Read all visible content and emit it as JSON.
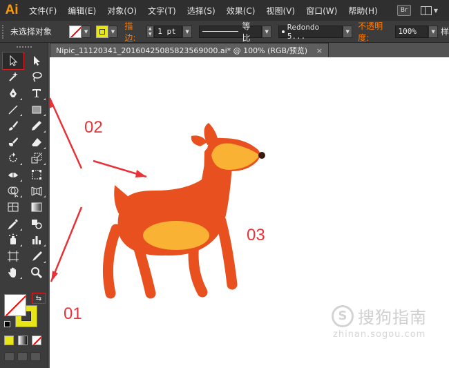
{
  "app": {
    "logo": "Ai",
    "bridge_label": "Br",
    "menus": [
      "文件(F)",
      "编辑(E)",
      "对象(O)",
      "文字(T)",
      "选择(S)",
      "效果(C)",
      "视图(V)",
      "窗口(W)",
      "帮助(H)"
    ]
  },
  "control": {
    "selection_status": "未选择对象",
    "stroke_label": "描边:",
    "stroke_weight": "1 pt",
    "stroke_profile": "等比",
    "brush": "Redondo 5...",
    "opacity_label": "不透明度:",
    "opacity_value": "100%",
    "trailing": "样"
  },
  "document": {
    "tab_title": "Nipic_11120341_20160425085823569000.ai* @ 100% (RGB/预览)",
    "close_symbol": "×"
  },
  "tools": [
    {
      "name": "selection-tool",
      "icon": "arrow-icon",
      "selected": true
    },
    {
      "name": "direct-selection-tool",
      "icon": "white-arrow-icon"
    },
    {
      "name": "magic-wand-tool",
      "icon": "magic-wand-icon"
    },
    {
      "name": "lasso-tool",
      "icon": "lasso-icon"
    },
    {
      "name": "pen-tool",
      "icon": "pen-icon"
    },
    {
      "name": "type-tool",
      "icon": "type-icon"
    },
    {
      "name": "line-tool",
      "icon": "line-icon"
    },
    {
      "name": "rectangle-tool",
      "icon": "rectangle-icon"
    },
    {
      "name": "paintbrush-tool",
      "icon": "brush-icon"
    },
    {
      "name": "pencil-tool",
      "icon": "pencil-icon"
    },
    {
      "name": "blob-brush-tool",
      "icon": "blob-brush-icon"
    },
    {
      "name": "eraser-tool",
      "icon": "eraser-icon"
    },
    {
      "name": "rotate-tool",
      "icon": "rotate-icon"
    },
    {
      "name": "scale-tool",
      "icon": "scale-icon"
    },
    {
      "name": "width-tool",
      "icon": "width-icon"
    },
    {
      "name": "free-transform-tool",
      "icon": "free-transform-icon"
    },
    {
      "name": "shape-builder-tool",
      "icon": "shape-builder-icon"
    },
    {
      "name": "perspective-grid-tool",
      "icon": "perspective-grid-icon"
    },
    {
      "name": "mesh-tool",
      "icon": "mesh-icon"
    },
    {
      "name": "gradient-tool",
      "icon": "gradient-icon"
    },
    {
      "name": "eyedropper-tool",
      "icon": "eyedropper-icon"
    },
    {
      "name": "blend-tool",
      "icon": "blend-icon"
    },
    {
      "name": "symbol-sprayer-tool",
      "icon": "symbol-sprayer-icon"
    },
    {
      "name": "column-graph-tool",
      "icon": "column-graph-icon"
    },
    {
      "name": "artboard-tool",
      "icon": "artboard-icon"
    },
    {
      "name": "slice-tool",
      "icon": "slice-icon"
    },
    {
      "name": "hand-tool",
      "icon": "hand-icon"
    },
    {
      "name": "zoom-tool",
      "icon": "zoom-icon"
    }
  ],
  "colors": {
    "fill": "none",
    "stroke": "#e6e619",
    "deer_body": "#e8511f",
    "deer_accent": "#f9b234",
    "annotation": "#e63238"
  },
  "annotations": {
    "label_01": "01",
    "label_02": "02",
    "label_03": "03"
  },
  "watermark": {
    "logo": "S",
    "text": "搜狗指南",
    "url": "zhinan.sogou.com"
  }
}
